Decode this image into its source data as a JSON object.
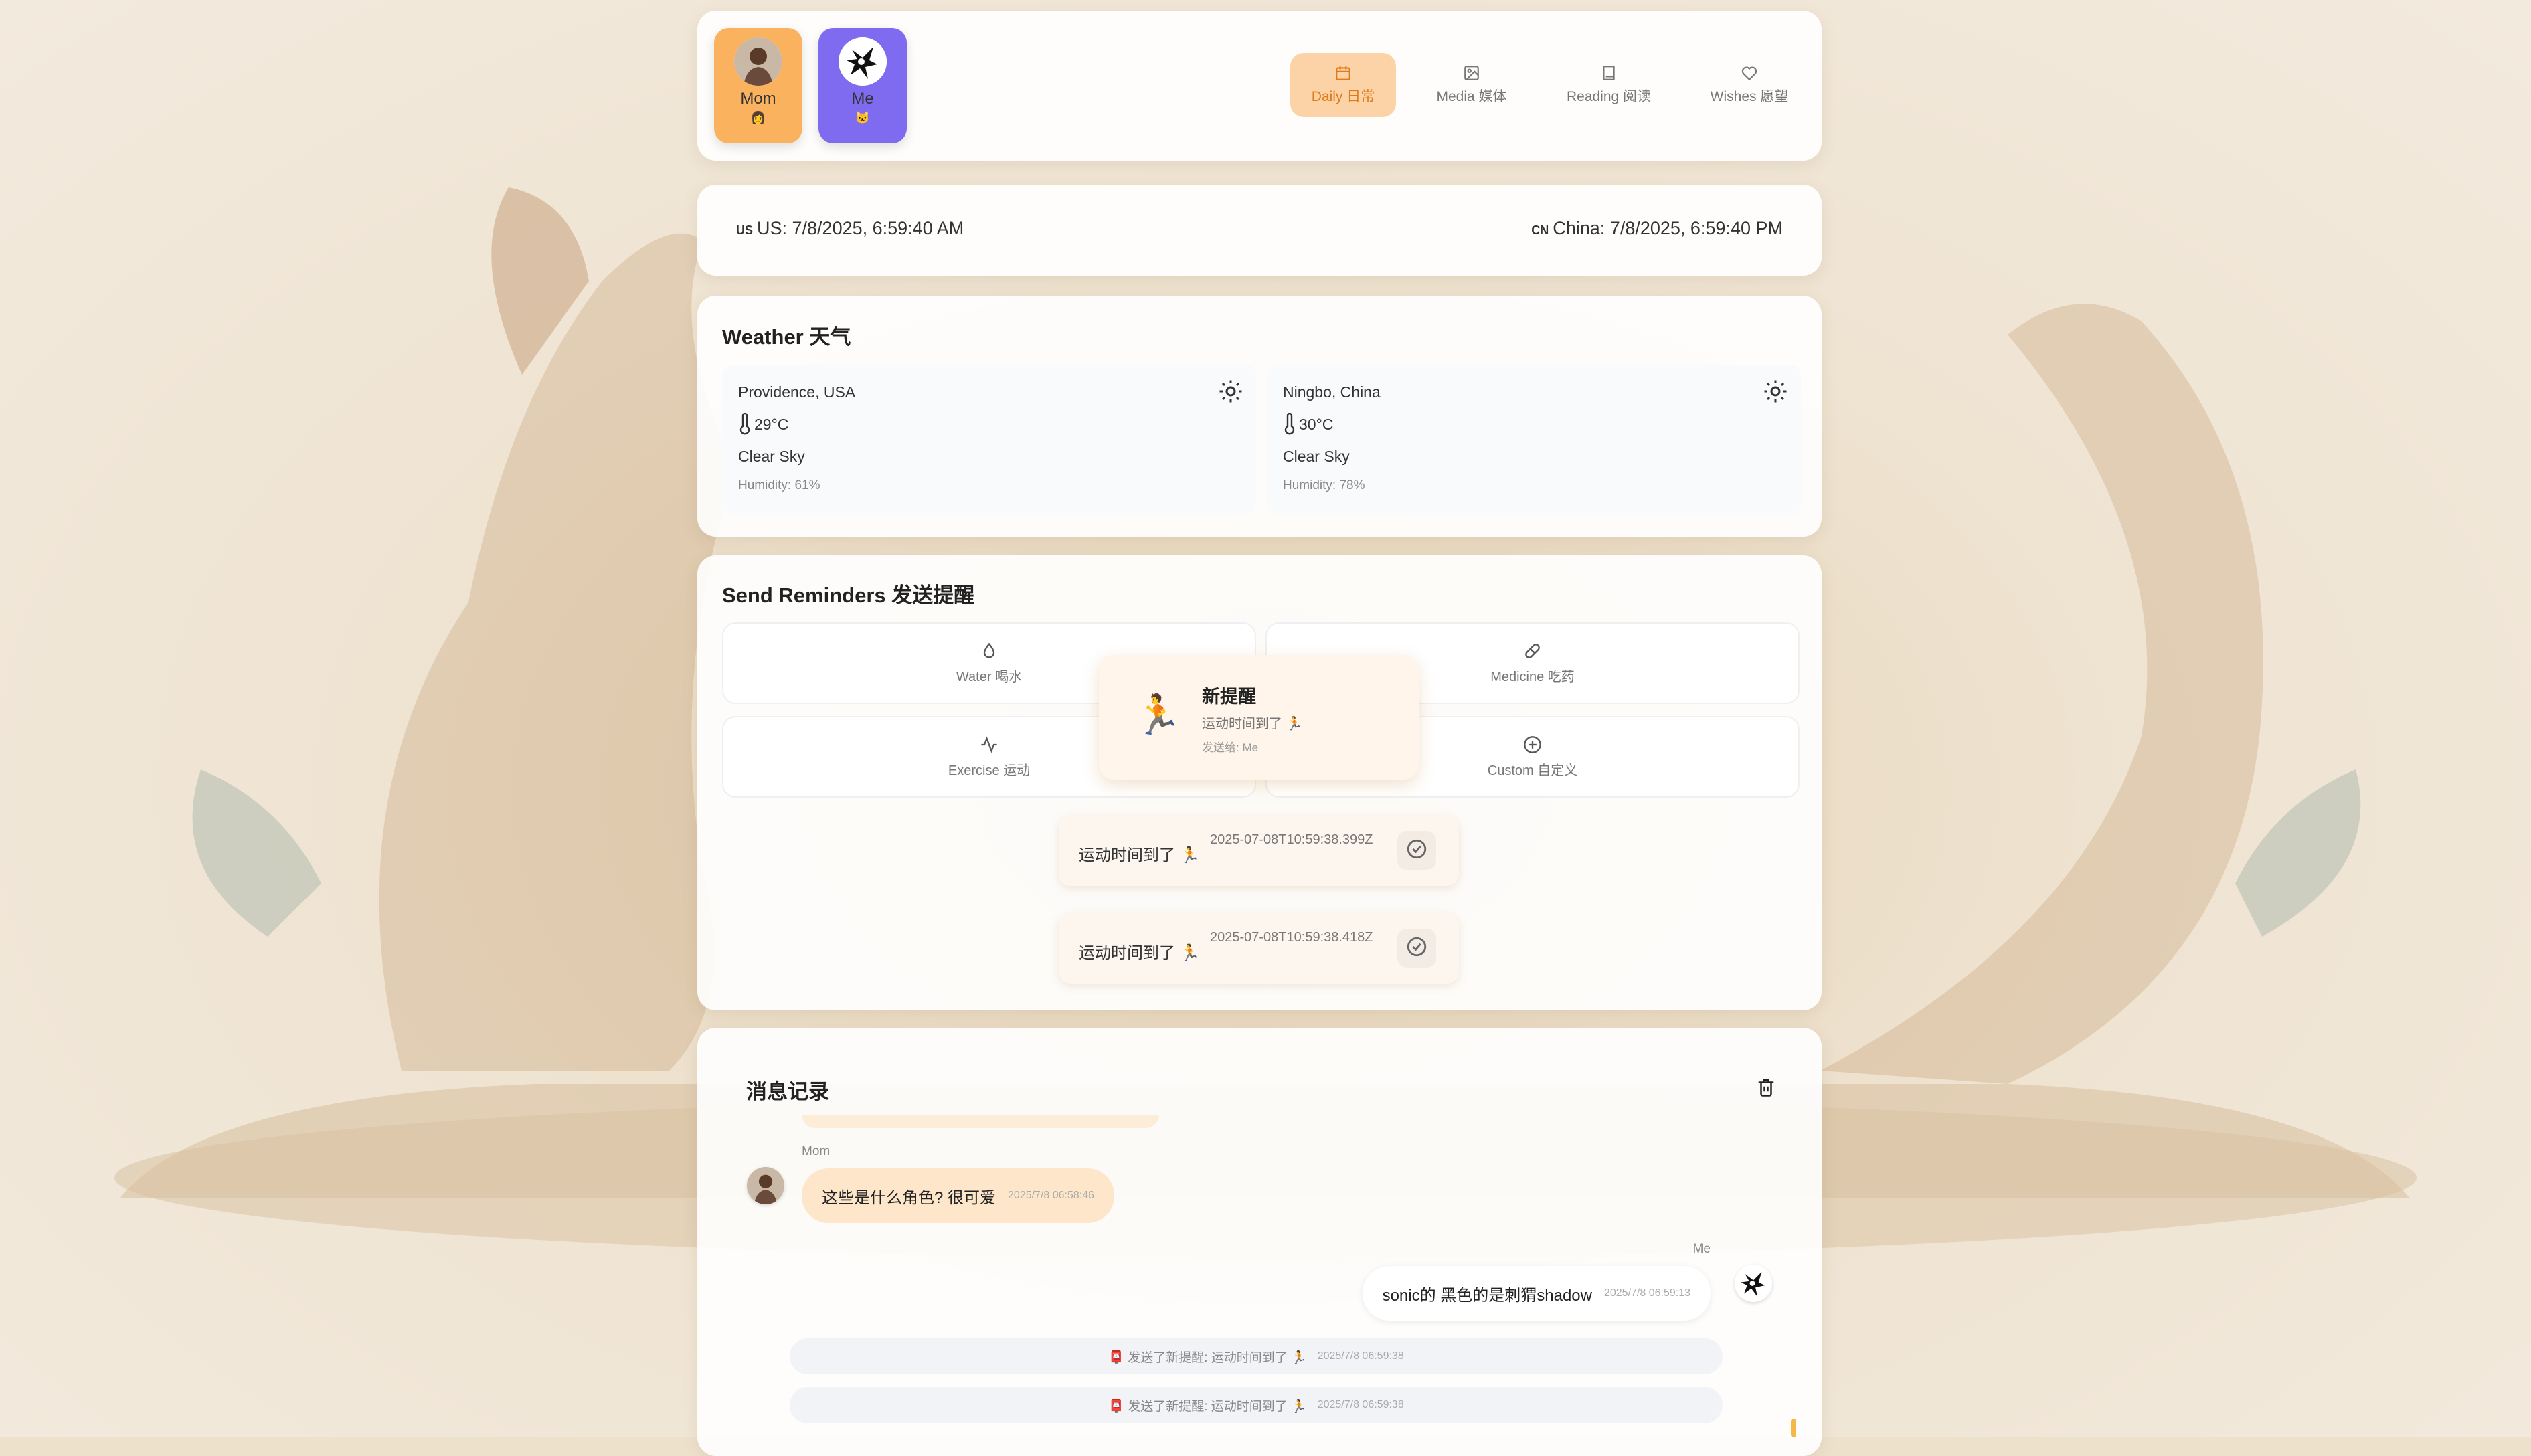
{
  "profiles": [
    {
      "name": "Mom",
      "emoji": "👩"
    },
    {
      "name": "Me",
      "emoji": "🐱"
    }
  ],
  "nav": [
    {
      "label": "Daily 日常",
      "icon": "calendar-icon",
      "active": true
    },
    {
      "label": "Media 媒体",
      "icon": "image-icon",
      "active": false
    },
    {
      "label": "Reading 阅读",
      "icon": "book-icon",
      "active": false
    },
    {
      "label": "Wishes 愿望",
      "icon": "heart-icon",
      "active": false
    }
  ],
  "clock": {
    "us_code": "US",
    "us_text": "US: 7/8/2025, 6:59:40 AM",
    "cn_code": "CN",
    "cn_text": "China: 7/8/2025, 6:59:40 PM"
  },
  "weather": {
    "title": "Weather 天气",
    "cities": [
      {
        "city": "Providence, USA",
        "temp": "29°C",
        "condition": "Clear Sky",
        "humidity": "Humidity: 61%"
      },
      {
        "city": "Ningbo, China",
        "temp": "30°C",
        "condition": "Clear Sky",
        "humidity": "Humidity: 78%"
      }
    ]
  },
  "reminders": {
    "title": "Send Reminders 发送提醒",
    "buttons": [
      {
        "label": "Water 喝水",
        "icon": "droplet-icon"
      },
      {
        "label": "Medicine 吃药",
        "icon": "pill-icon"
      },
      {
        "label": "Exercise 运动",
        "icon": "activity-icon"
      },
      {
        "label": "Custom 自定义",
        "icon": "plus-circle-icon"
      }
    ],
    "notification": {
      "emoji": "🏃",
      "title": "新提醒",
      "body": "运动时间到了 🏃",
      "sent_to": "发送给: Me"
    },
    "toasts": [
      {
        "message": "运动时间到了 🏃",
        "timestamp": "2025-07-08T10:59:38.399Z"
      },
      {
        "message": "运动时间到了 🏃",
        "timestamp": "2025-07-08T10:59:38.418Z"
      }
    ]
  },
  "messages": {
    "title": "消息记录",
    "items": [
      {
        "sender": "Mom",
        "text": "这些是什么角色? 很可爱",
        "time": "2025/7/8 06:58:46"
      },
      {
        "sender": "Me",
        "text": "sonic的 黑色的是刺猬shadow",
        "time": "2025/7/8 06:59:13"
      }
    ],
    "system": [
      {
        "text": "📮 发送了新提醒: 运动时间到了 🏃",
        "time": "2025/7/8 06:59:38"
      },
      {
        "text": "📮 发送了新提醒: 运动时间到了 🏃",
        "time": "2025/7/8 06:59:38"
      }
    ]
  },
  "colors": {
    "accent": "#e07a1a",
    "mom_card": "#fbb25f",
    "me_card": "#7f6bf0",
    "mom_bubble": "#fde6c9"
  }
}
